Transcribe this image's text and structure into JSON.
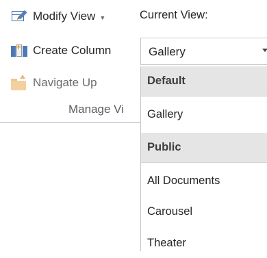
{
  "ribbon": {
    "modify_view": "Modify View",
    "create_column": "Create Column",
    "navigate_up": "Navigate Up",
    "group_label": "Manage Vi",
    "current_view_label": "Current View:"
  },
  "view_selector": {
    "selected": "Gallery",
    "groups": [
      {
        "header": "Default",
        "options": [
          "Gallery"
        ]
      },
      {
        "header": "Public",
        "options": [
          "All Documents",
          "Carousel",
          "Theater"
        ]
      }
    ]
  },
  "colors": {
    "header_bg": "#e5e5e5",
    "icon_blue": "#3f6fa8",
    "group_divider": "#9fb3c8"
  },
  "icons": [
    "modify-view-icon",
    "create-column-icon",
    "navigate-up-icon",
    "dropdown-arrow-icon"
  ]
}
